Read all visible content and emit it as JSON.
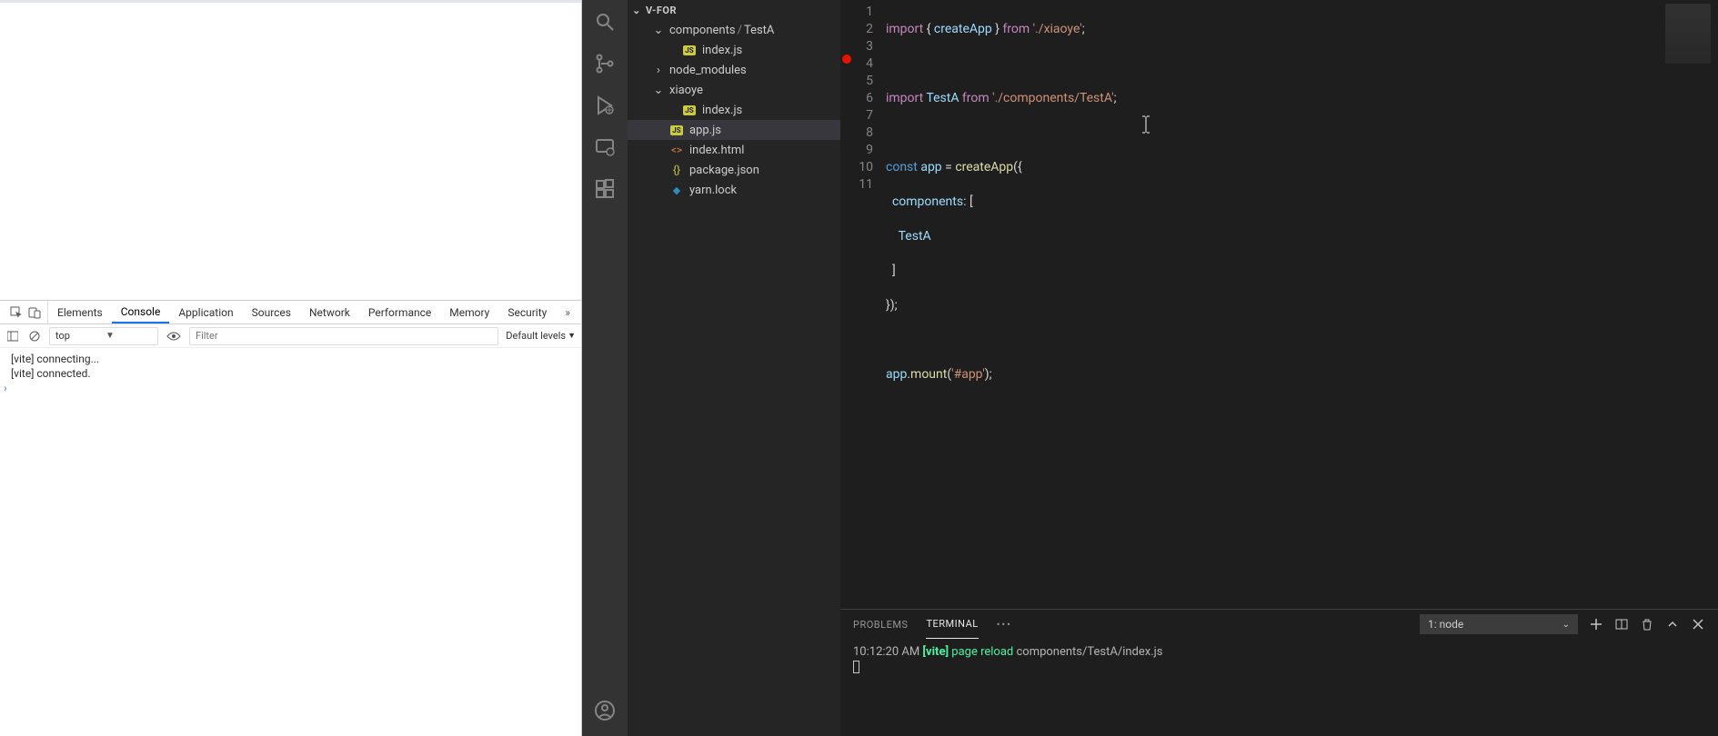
{
  "devtools": {
    "tabs": [
      "Elements",
      "Console",
      "Application",
      "Sources",
      "Network",
      "Performance",
      "Memory",
      "Security"
    ],
    "active_tab": "Console",
    "context": "top",
    "filter_placeholder": "Filter",
    "levels_label": "Default levels",
    "console_lines": [
      "[vite] connecting...",
      "[vite] connected."
    ]
  },
  "vscode": {
    "explorer": {
      "root": "V-FOR",
      "nodes": [
        {
          "type": "folder-open",
          "depth": 2,
          "label": "components",
          "suffix": "TestA"
        },
        {
          "type": "file-js",
          "depth": 3,
          "label": "index.js"
        },
        {
          "type": "folder-closed",
          "depth": 2,
          "label": "node_modules"
        },
        {
          "type": "folder-open",
          "depth": 2,
          "label": "xiaoye"
        },
        {
          "type": "file-js",
          "depth": 3,
          "label": "index.js"
        },
        {
          "type": "file-js",
          "depth": 2,
          "label": "app.js",
          "selected": true
        },
        {
          "type": "file-html",
          "depth": 2,
          "label": "index.html"
        },
        {
          "type": "file-json",
          "depth": 2,
          "label": "package.json"
        },
        {
          "type": "file-yarn",
          "depth": 2,
          "label": "yarn.lock"
        }
      ]
    },
    "editor": {
      "linecount": 11,
      "code": {
        "l1_import": "import",
        "l1_brace_o": "{ ",
        "l1_id": "createApp",
        "l1_brace_c": " }",
        "l1_from": " from ",
        "l1_str": "'./xiaoye'",
        "l1_semi": ";",
        "l3_import": "import ",
        "l3_id": "TestA",
        "l3_from": " from ",
        "l3_str": "'./components/TestA'",
        "l3_semi": ";",
        "l5_const": "const ",
        "l5_app": "app",
        "l5_eq": " = ",
        "l5_fn": "createApp",
        "l5_open": "({",
        "l6_prop": "  components",
        "l6_colon": ": [",
        "l7_testa": "    TestA",
        "l8_close": "  ]",
        "l9_close": "});",
        "l11_app": "app",
        "l11_dot": ".",
        "l11_mount": "mount",
        "l11_paren": "(",
        "l11_str": "'#app'",
        "l11_end": ");"
      }
    },
    "panel": {
      "tabs": [
        "PROBLEMS",
        "TERMINAL"
      ],
      "active": "TERMINAL",
      "terminal_selector": "1: node",
      "line": {
        "time": "10:12:20 AM ",
        "tag": "[vite]",
        "action": " page reload ",
        "path": "components/TestA/index.js"
      }
    }
  }
}
